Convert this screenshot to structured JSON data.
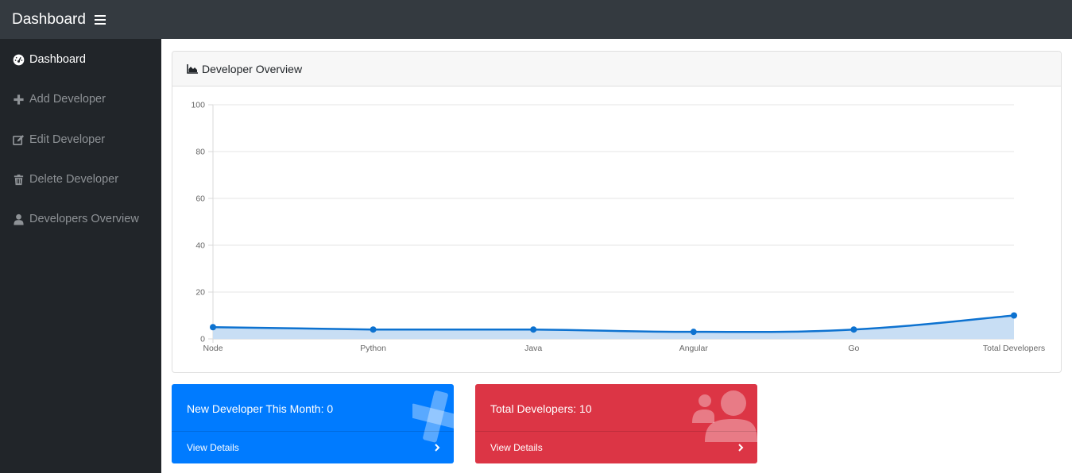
{
  "header": {
    "title": "Dashboard",
    "menu_icon": "bars-icon"
  },
  "sidebar": {
    "items": [
      {
        "label": "Dashboard",
        "icon": "tachometer-icon",
        "active": true
      },
      {
        "label": "Add Developer",
        "icon": "plus-icon",
        "active": false
      },
      {
        "label": "Edit Developer",
        "icon": "edit-icon",
        "active": false
      },
      {
        "label": "Delete Developer",
        "icon": "trash-icon",
        "active": false
      },
      {
        "label": "Developers Overview",
        "icon": "user-icon",
        "active": false
      }
    ]
  },
  "overview": {
    "title": "Developer Overview",
    "icon": "area-chart-icon"
  },
  "chart_data": {
    "type": "area",
    "categories": [
      "Node",
      "Python",
      "Java",
      "Angular",
      "Go",
      "Total Developers"
    ],
    "values": [
      5,
      4,
      4,
      3,
      4,
      10
    ],
    "ylim": [
      0,
      100
    ],
    "yticks": [
      0,
      20,
      40,
      60,
      80,
      100
    ],
    "grid": true,
    "line_color": "#0d72d0",
    "fill_color": "#c8def4"
  },
  "cards": [
    {
      "title": "New Developer This Month: 0",
      "link": "View Details",
      "color": "#007bff",
      "icon": "plus-icon"
    },
    {
      "title": "Total Developers: 10",
      "link": "View Details",
      "color": "#dc3545",
      "icon": "users-icon"
    }
  ],
  "colors": {
    "topbar": "#343a40",
    "sidebar": "#212529",
    "primary": "#007bff",
    "danger": "#dc3545"
  }
}
